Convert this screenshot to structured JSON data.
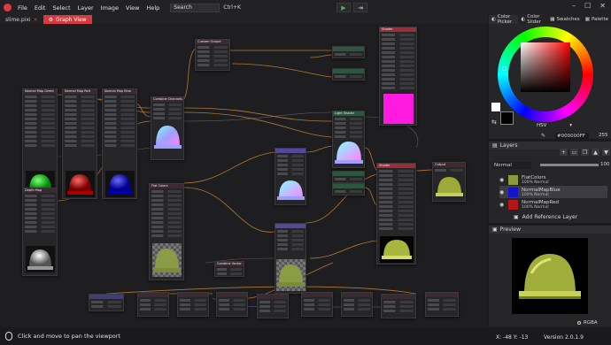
{
  "menu": {
    "items": [
      "File",
      "Edit",
      "Select",
      "Layer",
      "Image",
      "View",
      "Help"
    ],
    "search_placeholder": "Search",
    "search_shortcut": "Ctrl+K"
  },
  "tabs": [
    {
      "label": "slime.pixi"
    },
    {
      "label": "Graph View"
    }
  ],
  "graph": {
    "nodes": [
      {
        "title": "Normal Map Green",
        "color": "tan"
      },
      {
        "title": "Normal Map Red",
        "color": "tan"
      },
      {
        "title": "Normal Map Blue",
        "color": "tan"
      },
      {
        "title": "Combine Channels",
        "color": "tan"
      },
      {
        "title": "Custom Output",
        "color": "tan"
      },
      {
        "title": "Depth Map",
        "color": "tan"
      },
      {
        "title": "Flat Colors",
        "color": "tan"
      },
      {
        "title": "Light Shader",
        "color": "green"
      },
      {
        "title": "Shader",
        "color": "red"
      },
      {
        "title": "Output",
        "color": "tan"
      },
      {
        "title": "Combine Vector",
        "color": "tan"
      }
    ]
  },
  "panels": {
    "tabs": [
      "Color Picker",
      "Color Slider",
      "Swatches",
      "Palette"
    ],
    "color_mode": "HSV",
    "hex": "#000000FF",
    "alpha": "255"
  },
  "layers": {
    "title": "Layers",
    "blend_mode": "Normal",
    "opacity": "100",
    "items": [
      {
        "name": "FlatColors",
        "sub": "100% Normal",
        "color": "#8a9a3d"
      },
      {
        "name": "NormalMapBlue",
        "sub": "100% Normal",
        "color": "#1414c8"
      },
      {
        "name": "NormalMapRed",
        "sub": "100% Normal",
        "color": "#b01818"
      }
    ],
    "add_reference": "Add Reference Layer"
  },
  "preview": {
    "title": "Preview",
    "mode": "RGBA"
  },
  "status": {
    "hint": "Click and move to pan the viewport",
    "coords": "X: -48 Y: -13",
    "version": "Version 2.0.1.9"
  }
}
